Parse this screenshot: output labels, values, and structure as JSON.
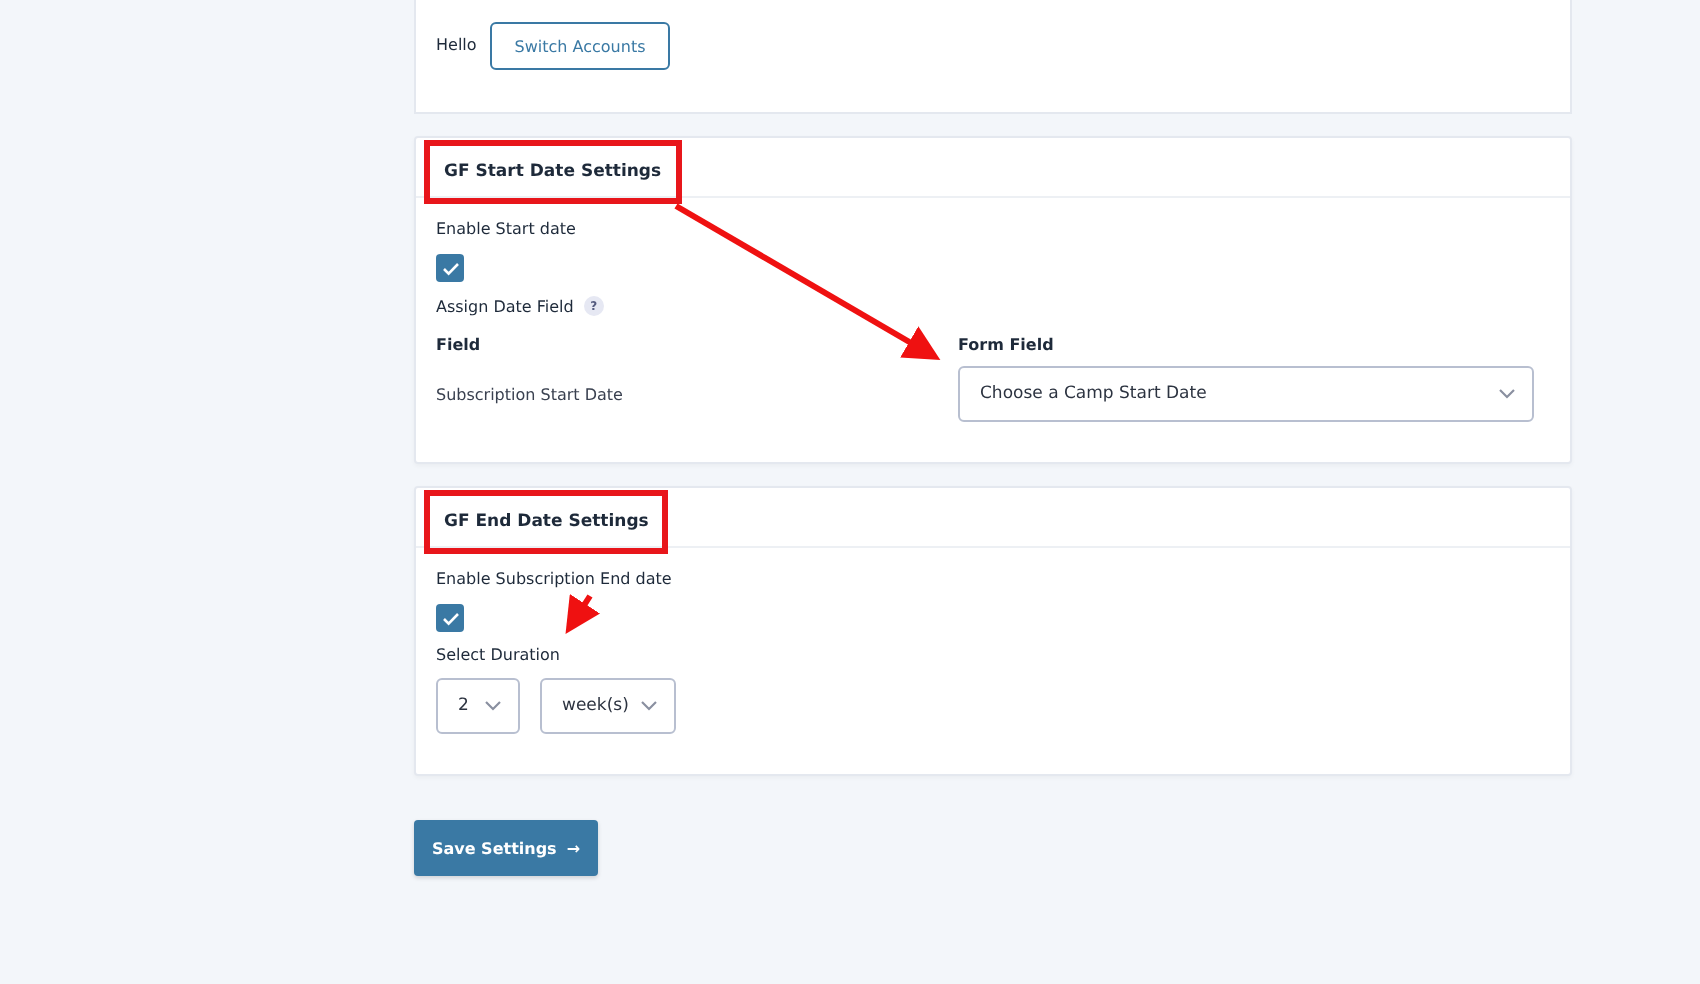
{
  "account": {
    "greeting": "Hello",
    "switch_button": "Switch Accounts"
  },
  "sections": [
    {
      "title": "GF Start Date Settings",
      "highlighted": true,
      "fields": [
        {
          "kind": "checkbox",
          "label": "Enable Start date",
          "checked": true
        },
        {
          "kind": "label",
          "label": "Assign Date Field",
          "help": "?"
        },
        {
          "kind": "mapping",
          "columns": [
            "Field",
            "Form Field"
          ],
          "rows": [
            {
              "field": "Subscription Start Date",
              "value": "Choose a Camp Start Date"
            }
          ]
        }
      ]
    },
    {
      "title": "GF End Date Settings",
      "highlighted": true,
      "fields": [
        {
          "kind": "checkbox",
          "label": "Enable Subscription End date",
          "checked": true
        },
        {
          "kind": "duration",
          "label": "Select Duration",
          "count": "2",
          "unit": "week(s)"
        }
      ]
    }
  ],
  "save_button": {
    "label": "Save Settings",
    "arrow": "→"
  }
}
